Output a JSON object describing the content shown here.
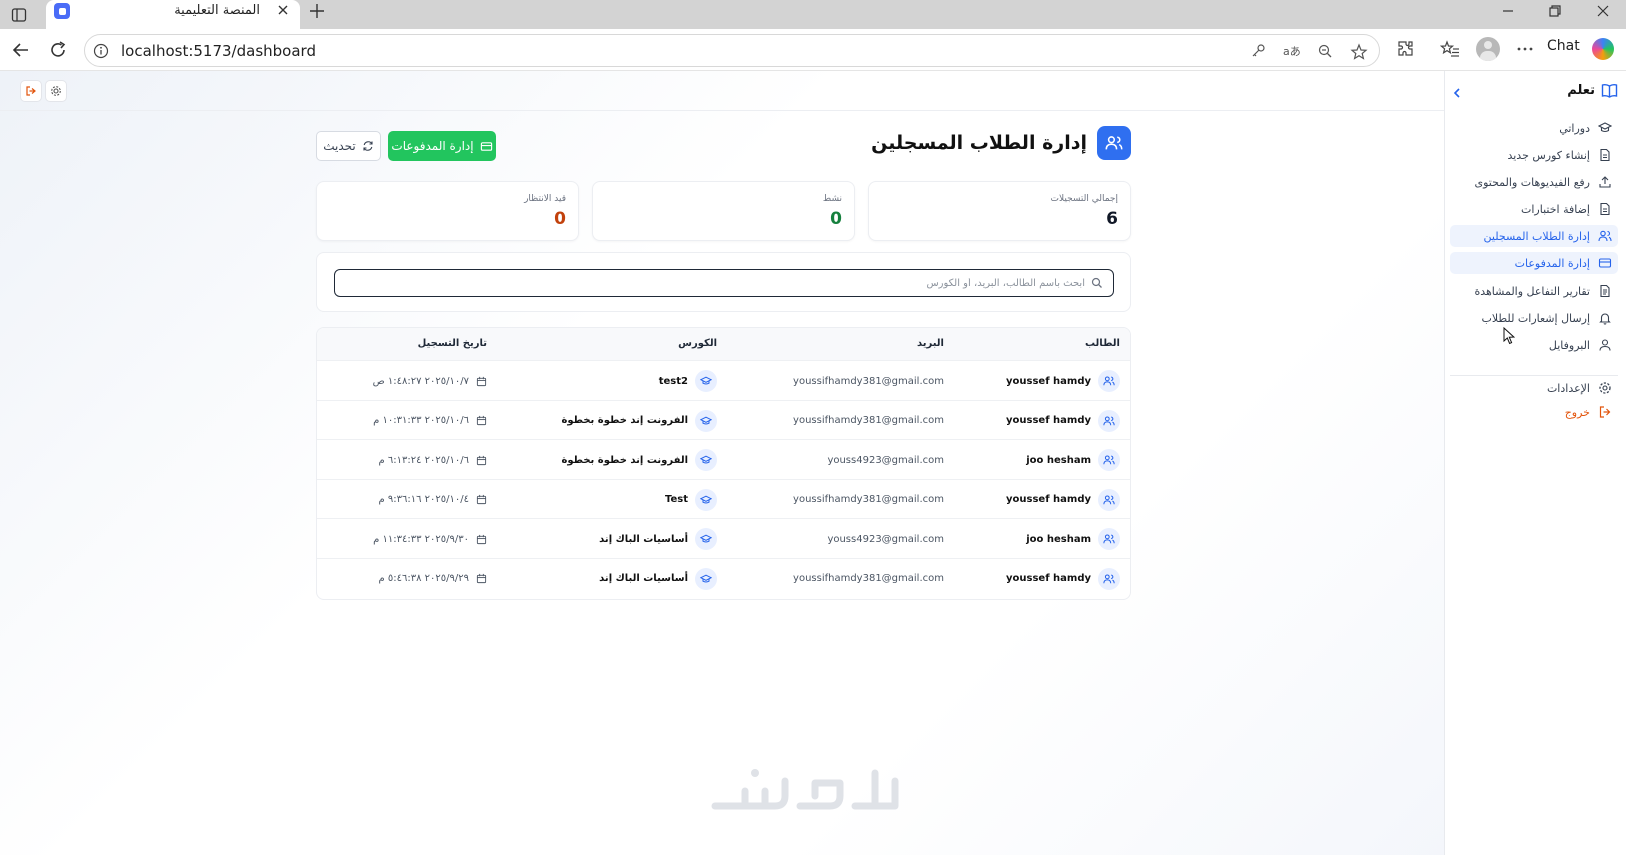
{
  "browser": {
    "tab_title": "المنصة التعليمية",
    "url": "localhost:5173/dashboard",
    "chat_label": "Chat"
  },
  "sidebar": {
    "brand": "تعلم",
    "items": [
      {
        "label": "دوراتي",
        "icon": "graduation-cap-icon"
      },
      {
        "label": "إنشاء كورس جديد",
        "icon": "document-icon"
      },
      {
        "label": "رفع الفيديوهات والمحتوى",
        "icon": "upload-icon"
      },
      {
        "label": "إضافة اختبارات",
        "icon": "document-icon"
      },
      {
        "label": "إدارة الطلاب المسجلين",
        "icon": "users-icon",
        "active": true
      },
      {
        "label": "إدارة المدفوعات",
        "icon": "credit-card-icon",
        "active": true
      },
      {
        "label": "تقارير التفاعل والمشاهدة",
        "icon": "report-icon"
      },
      {
        "label": "إرسال إشعارات للطلاب",
        "icon": "bell-icon"
      },
      {
        "label": "البروفايل",
        "icon": "user-icon"
      }
    ],
    "settings": "الإعدادات",
    "logout": "خروج"
  },
  "header": {
    "title": "إدارة الطلاب المسجلين",
    "payments_button": "إدارة المدفوعات",
    "refresh_button": "تحديث"
  },
  "stats": [
    {
      "label": "إجمالي التسجيلات",
      "value": "6",
      "color": "#111827"
    },
    {
      "label": "نشط",
      "value": "0",
      "color": "#15803d"
    },
    {
      "label": "قيد الانتظار",
      "value": "0",
      "color": "#c2410c"
    }
  ],
  "search": {
    "placeholder": "ابحث باسم الطالب، البريد، أو الكورس",
    "value": ""
  },
  "table": {
    "headers": {
      "student": "الطالب",
      "email": "البريد",
      "course": "الكورس",
      "date": "تاريخ التسجيل"
    },
    "rows": [
      {
        "student": "youssef hamdy",
        "email": "youssifhamdy381@gmail.com",
        "course": "test2",
        "date": "٢٠٢٥/١٠/٧ ١:٤٨:٢٧ ص"
      },
      {
        "student": "youssef hamdy",
        "email": "youssifhamdy381@gmail.com",
        "course": "الفرونت إند خطوة بخطوة",
        "date": "٢٠٢٥/١٠/٦ ١٠:٣١:٣٣ م"
      },
      {
        "student": "joo hesham",
        "email": "youss4923@gmail.com",
        "course": "الفرونت إند خطوة بخطوة",
        "date": "٢٠٢٥/١٠/٦ ٦:١٣:٢٤ م"
      },
      {
        "student": "youssef hamdy",
        "email": "youssifhamdy381@gmail.com",
        "course": "Test",
        "date": "٢٠٢٥/١٠/٤ ٩:٣٦:١٦ م"
      },
      {
        "student": "joo hesham",
        "email": "youss4923@gmail.com",
        "course": "أساسيات الباك إند",
        "date": "٢٠٢٥/٩/٣٠ ١١:٣٤:٣٣ م"
      },
      {
        "student": "youssef hamdy",
        "email": "youssifhamdy381@gmail.com",
        "course": "أساسيات الباك إند",
        "date": "٢٠٢٥/٩/٢٩ ٥:٤٦:٣٨ م"
      }
    ]
  },
  "colors": {
    "primary": "#2f6ff0",
    "success": "#22c55e",
    "accent_orange": "#e2540c"
  }
}
